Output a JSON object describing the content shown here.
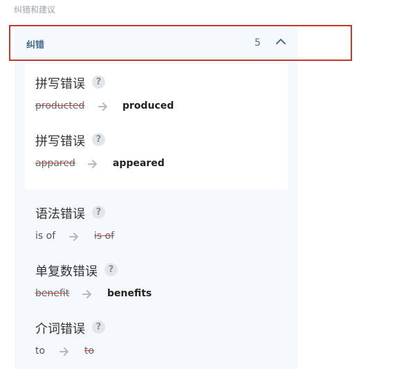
{
  "section_title": "纠错和建议",
  "header": {
    "title": "纠错",
    "count": "5",
    "chevron_icon": "chevron-up-icon"
  },
  "help_glyph": "?",
  "corrections": [
    {
      "type": "拼写错误",
      "original": "producted",
      "suggestion": "produced"
    },
    {
      "type": "拼写错误",
      "original": "appared",
      "suggestion": "appeared"
    },
    {
      "type": "语法错误",
      "original": "is of",
      "suggestion": "is of"
    },
    {
      "type": "单复数错误",
      "original": "benefit",
      "suggestion": "benefits"
    },
    {
      "type": "介词错误",
      "original": "to",
      "suggestion": "to"
    }
  ]
}
